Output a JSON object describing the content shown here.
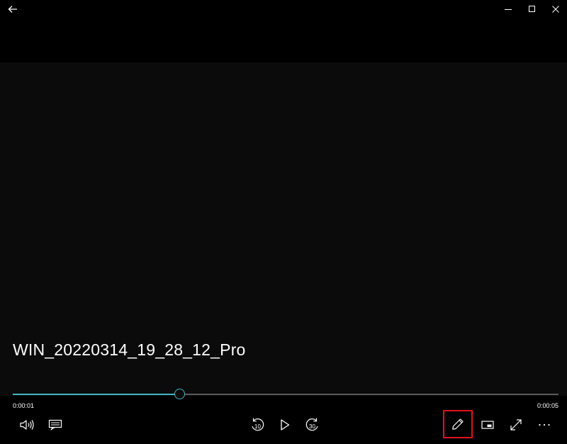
{
  "titlebar": {
    "icons": [
      "back-arrow-icon",
      "minimize-icon",
      "maximize-icon",
      "close-icon"
    ]
  },
  "media": {
    "title": "WIN_20220314_19_28_12_Pro",
    "current_time": "0:00:01",
    "total_time": "0:00:05",
    "progress": 0.306
  },
  "controls": {
    "rewind_seconds": "10",
    "forward_seconds": "30",
    "icons": [
      "volume-icon",
      "captions-icon",
      "skip-back-icon",
      "play-icon",
      "skip-forward-icon",
      "pencil-icon",
      "mini-view-icon",
      "fullscreen-icon",
      "more-icon"
    ]
  },
  "colors": {
    "accent": "#3fb6c2",
    "highlight_box": "#e0141e",
    "background": "#000000"
  }
}
